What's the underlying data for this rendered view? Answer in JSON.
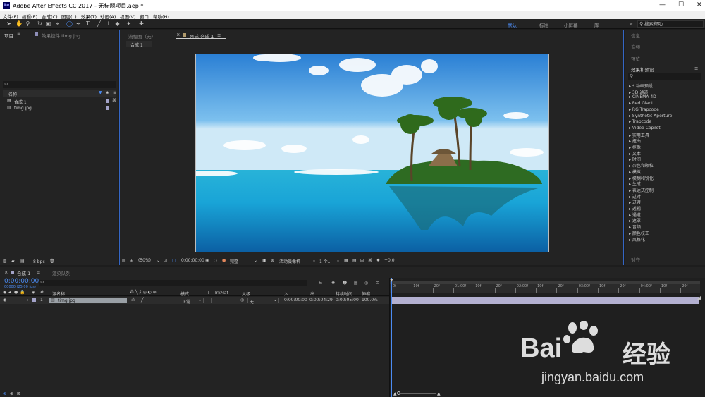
{
  "window": {
    "title": "Adobe After Effects CC 2017 - 无标题项目.aep *",
    "logo": "Ae",
    "minimize": "—",
    "maximize": "☐",
    "close": "✕"
  },
  "menu": [
    "文件(F)",
    "编辑(E)",
    "合成(C)",
    "图层(L)",
    "效果(T)",
    "动画(A)",
    "视图(V)",
    "窗口",
    "帮助(H)"
  ],
  "workspaces": [
    "默认",
    "标准",
    "小屏幕",
    "库"
  ],
  "search_help": {
    "placeholder": "搜索帮助"
  },
  "project_panel": {
    "tab": "项目",
    "tab2": "效果控件 timg.jpg",
    "col_name": "名称",
    "items": [
      {
        "name": "合成 1",
        "type": "composition"
      },
      {
        "name": "timg.jpg",
        "type": "footage"
      }
    ],
    "bpc": "8 bpc"
  },
  "viewer": {
    "tab_flow": "流程图（无）",
    "tab_comp": "合成 合成 1",
    "breadcrumb": "合成 1",
    "zoom": "(50%)",
    "timecode": "0:00:00:00",
    "quality": "完整",
    "camera": "活动摄像机",
    "views": "1 个...",
    "exposure": "+0.0"
  },
  "right_panels": {
    "info": "信息",
    "audio": "音频",
    "preview": "预览",
    "effects": "效果和预设",
    "bottom": "对齐",
    "effect_categories": [
      "* 动画预设",
      "3D 通道",
      "CINEMA 4D",
      "Red Giant",
      "RG Trapcode",
      "Synthetic Aperture",
      "Trapcode",
      "Video Copilot",
      "实用工具",
      "扭曲",
      "抠像",
      "文本",
      "时间",
      "杂色和颗粒",
      "模拟",
      "模糊和锐化",
      "生成",
      "表达式控制",
      "过时",
      "过渡",
      "透视",
      "通道",
      "遮罩",
      "音频",
      "颜色校正",
      "风格化"
    ]
  },
  "timeline": {
    "tab": "合成 1",
    "tab2": "渲染队列",
    "timecode": "0:00:00:00",
    "frames": "00000 (25.00 fps)",
    "headers": {
      "src": "源名称",
      "mode": "模式",
      "t": "T",
      "trkmat": "TrkMat",
      "parent": "父级",
      "in": "入",
      "out": "出",
      "duration": "持续时间",
      "stretch": "伸缩"
    },
    "layer": {
      "num": "1",
      "name": "timg.jpg",
      "mode": "正常",
      "parent": "无",
      "in": "0:00:00:00",
      "out": "0:00:04:29",
      "duration": "0:00:05:00",
      "stretch": "100.0%"
    },
    "ruler": [
      "0f",
      "10f",
      "20f",
      "01:00f",
      "10f",
      "20f",
      "02:00f",
      "10f",
      "20f",
      "03:00f",
      "10f",
      "20f",
      "04:00f",
      "10f",
      "20f"
    ]
  },
  "watermark": {
    "brand": "Bai",
    "brand2": "经验",
    "url": "jingyan.baidu.com"
  }
}
